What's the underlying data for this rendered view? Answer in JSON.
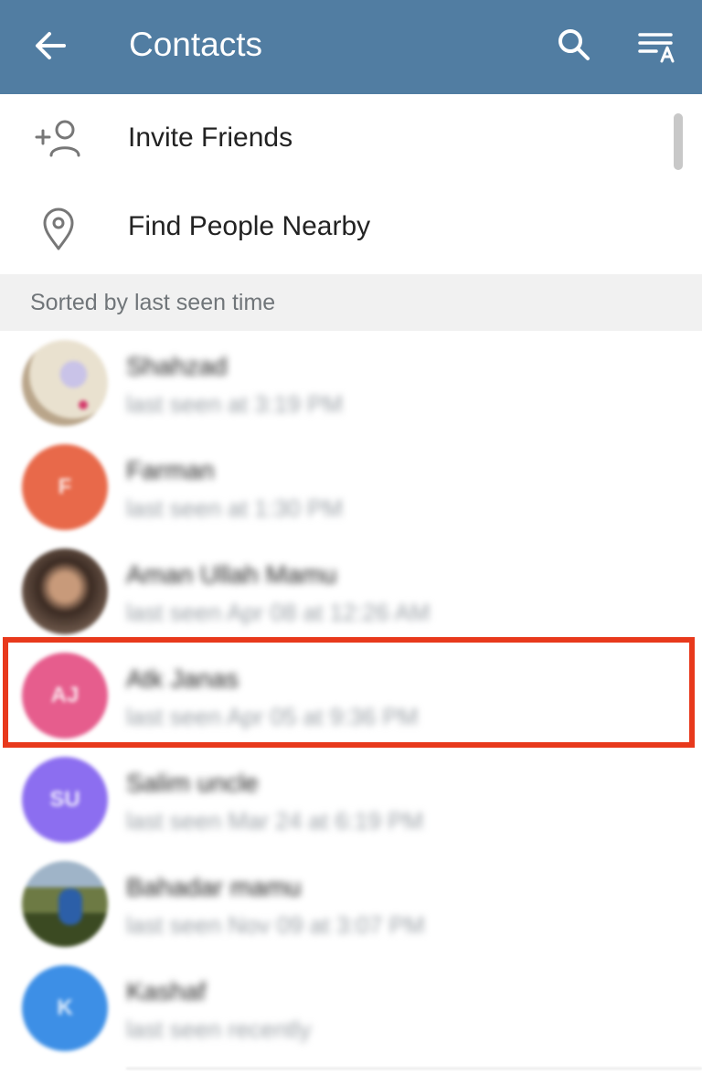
{
  "header": {
    "title": "Contacts",
    "background_color": "#517da2",
    "back_icon": "arrow-left-icon",
    "search_icon": "search-icon",
    "sort_icon": "sort-alpha-icon"
  },
  "actions": [
    {
      "label": "Invite Friends",
      "icon": "add-person-icon"
    },
    {
      "label": "Find People Nearby",
      "icon": "location-pin-icon"
    }
  ],
  "section_header": "Sorted by last seen time",
  "contacts": [
    {
      "name": "Shahzad",
      "status": "last seen at 3:19 PM",
      "avatar_initials": "",
      "avatar_color": "#d8d2c4"
    },
    {
      "name": "Farman",
      "status": "last seen at 1:30 PM",
      "avatar_initials": "F",
      "avatar_color": "#e8694a"
    },
    {
      "name": "Aman Ullah Mamu",
      "status": "last seen Apr 08 at 12:26 AM",
      "avatar_initials": "",
      "avatar_color": "#4a3a32"
    },
    {
      "name": "Atk Janas",
      "status": "last seen Apr 05 at 9:36 PM",
      "avatar_initials": "AJ",
      "avatar_color": "#e65d8d"
    },
    {
      "name": "Salim uncle",
      "status": "last seen Mar 24 at 6:19 PM",
      "avatar_initials": "SU",
      "avatar_color": "#8c6ef0"
    },
    {
      "name": "Bahadar mamu",
      "status": "last seen Nov 09 at 3:07 PM",
      "avatar_initials": "",
      "avatar_color": "#5b6b3a"
    },
    {
      "name": "Kashaf",
      "status": "last seen recently",
      "avatar_initials": "K",
      "avatar_color": "#3d8fe6"
    }
  ],
  "highlight_color": "#e8391c"
}
